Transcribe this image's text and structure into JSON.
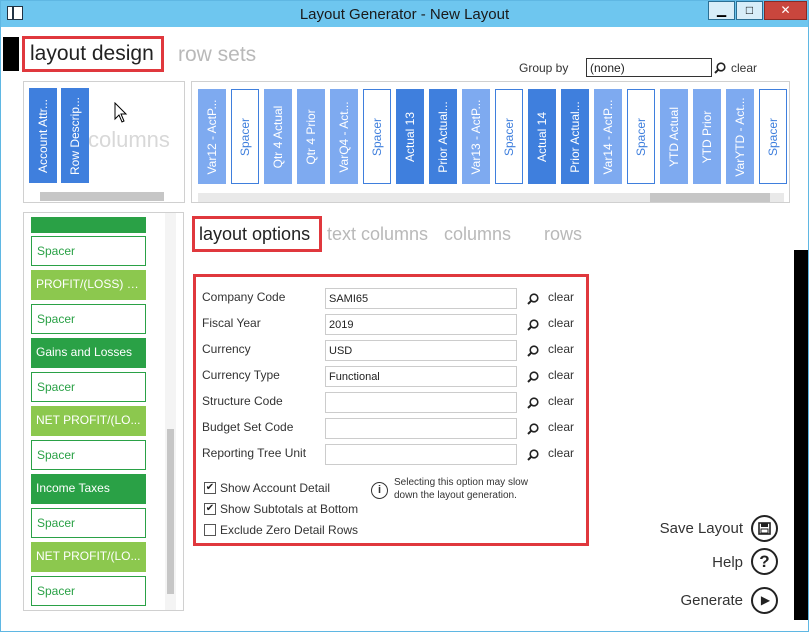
{
  "window": {
    "title": "Layout Generator - New Layout"
  },
  "tabs": {
    "layout_design": "layout design",
    "row_sets": "row sets"
  },
  "group_by": {
    "label": "Group by",
    "value": "(none)",
    "clear": "clear"
  },
  "left_columns": {
    "watermark": "columns",
    "items": [
      {
        "label": "Account Attr...",
        "style": "blue"
      },
      {
        "label": "Row Descrip...",
        "style": "blue"
      }
    ]
  },
  "columns": [
    {
      "label": "Var12 - ActP...",
      "style": "lblue"
    },
    {
      "label": "Spacer",
      "style": "spacer"
    },
    {
      "label": "Qtr 4 Actual",
      "style": "lblue"
    },
    {
      "label": "Qtr 4 Prior",
      "style": "lblue"
    },
    {
      "label": "VarQ4 - Act...",
      "style": "lblue"
    },
    {
      "label": "Spacer",
      "style": "spacer"
    },
    {
      "label": "Actual 13",
      "style": "blue"
    },
    {
      "label": "Prior Actual...",
      "style": "blue"
    },
    {
      "label": "Var13 - ActP...",
      "style": "lblue"
    },
    {
      "label": "Spacer",
      "style": "spacer"
    },
    {
      "label": "Actual 14",
      "style": "blue"
    },
    {
      "label": "Prior Actual...",
      "style": "blue"
    },
    {
      "label": "Var14 - ActP...",
      "style": "lblue"
    },
    {
      "label": "Spacer",
      "style": "spacer"
    },
    {
      "label": "YTD Actual",
      "style": "lblue"
    },
    {
      "label": "YTD Prior",
      "style": "lblue"
    },
    {
      "label": "VarYTD - Act...",
      "style": "lblue"
    },
    {
      "label": "Spacer",
      "style": "spacer"
    }
  ],
  "rows": [
    {
      "label": "",
      "style": "dgreen"
    },
    {
      "label": "Spacer",
      "style": "spacer"
    },
    {
      "label": "PROFIT/(LOSS) B...",
      "style": "lgreen"
    },
    {
      "label": "Spacer",
      "style": "spacer"
    },
    {
      "label": "Gains and Losses",
      "style": "dgreen"
    },
    {
      "label": "Spacer",
      "style": "spacer"
    },
    {
      "label": "NET PROFIT/(LO...",
      "style": "lgreen"
    },
    {
      "label": "Spacer",
      "style": "spacer"
    },
    {
      "label": "Income Taxes",
      "style": "dgreen"
    },
    {
      "label": "Spacer",
      "style": "spacer"
    },
    {
      "label": "NET PROFIT/(LO...",
      "style": "lgreen"
    },
    {
      "label": "Spacer",
      "style": "spacer"
    }
  ],
  "sub_tabs": {
    "layout_options": "layout options",
    "text_columns": "text columns",
    "columns": "columns",
    "rows": "rows"
  },
  "options": {
    "fields": [
      {
        "label": "Company Code",
        "value": "SAMI65",
        "clear": "clear"
      },
      {
        "label": "Fiscal Year",
        "value": "2019",
        "clear": "clear"
      },
      {
        "label": "Currency",
        "value": "USD",
        "clear": "clear"
      },
      {
        "label": "Currency Type",
        "value": "Functional",
        "clear": "clear"
      },
      {
        "label": "Structure Code",
        "value": "",
        "clear": "clear"
      },
      {
        "label": "Budget Set Code",
        "value": "",
        "clear": "clear"
      },
      {
        "label": "Reporting Tree Unit",
        "value": "",
        "clear": "clear"
      }
    ],
    "checkboxes": [
      {
        "label": "Show Account Detail",
        "checked": true
      },
      {
        "label": "Show Subtotals at Bottom",
        "checked": true
      },
      {
        "label": "Exclude Zero Detail Rows",
        "checked": false
      }
    ],
    "info": "Selecting this option may slow down the layout generation."
  },
  "actions": {
    "save": "Save Layout",
    "help": "Help",
    "generate": "Generate"
  },
  "icons": {
    "check_mark": "✔",
    "min": "▁",
    "max": "□",
    "close": "✕",
    "info": "i",
    "help": "?",
    "play": "▶"
  }
}
